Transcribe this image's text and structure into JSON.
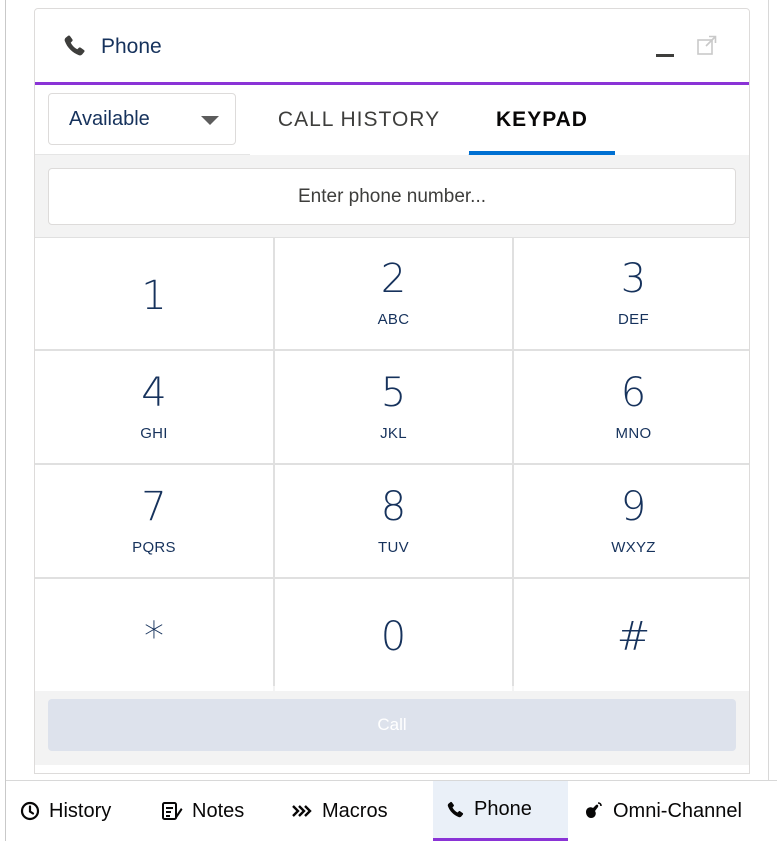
{
  "panel": {
    "title": "Phone",
    "icons": {
      "title": "phone-icon",
      "minimize": "minimize-icon",
      "popout": "popout-icon"
    }
  },
  "status": {
    "selected": "Available"
  },
  "tabs": [
    {
      "label": "CALL HISTORY",
      "active": false
    },
    {
      "label": "KEYPAD",
      "active": true
    }
  ],
  "phone_input": {
    "placeholder": "Enter phone number...",
    "value": ""
  },
  "keypad": [
    {
      "digit": "1",
      "letters": ""
    },
    {
      "digit": "2",
      "letters": "ABC"
    },
    {
      "digit": "3",
      "letters": "DEF"
    },
    {
      "digit": "4",
      "letters": "GHI"
    },
    {
      "digit": "5",
      "letters": "JKL"
    },
    {
      "digit": "6",
      "letters": "MNO"
    },
    {
      "digit": "7",
      "letters": "PQRS"
    },
    {
      "digit": "8",
      "letters": "TUV"
    },
    {
      "digit": "9",
      "letters": "WXYZ"
    },
    {
      "digit": "*",
      "letters": ""
    },
    {
      "digit": "0",
      "letters": ""
    },
    {
      "digit": "#",
      "letters": ""
    }
  ],
  "call_button": {
    "label": "Call",
    "disabled": true
  },
  "utility_bar": [
    {
      "label": "History",
      "icon": "clock-icon"
    },
    {
      "label": "Notes",
      "icon": "notes-icon"
    },
    {
      "label": "Macros",
      "icon": "macros-icon"
    },
    {
      "label": "Phone",
      "icon": "phone-icon",
      "active": true
    },
    {
      "label": "Omni-Channel",
      "icon": "omni-channel-icon"
    }
  ],
  "colors": {
    "accent_purple": "#8a33d6",
    "tab_underline_blue": "#0070d2",
    "text_dark": "#16325c",
    "call_disabled_bg": "#dde2ec"
  }
}
